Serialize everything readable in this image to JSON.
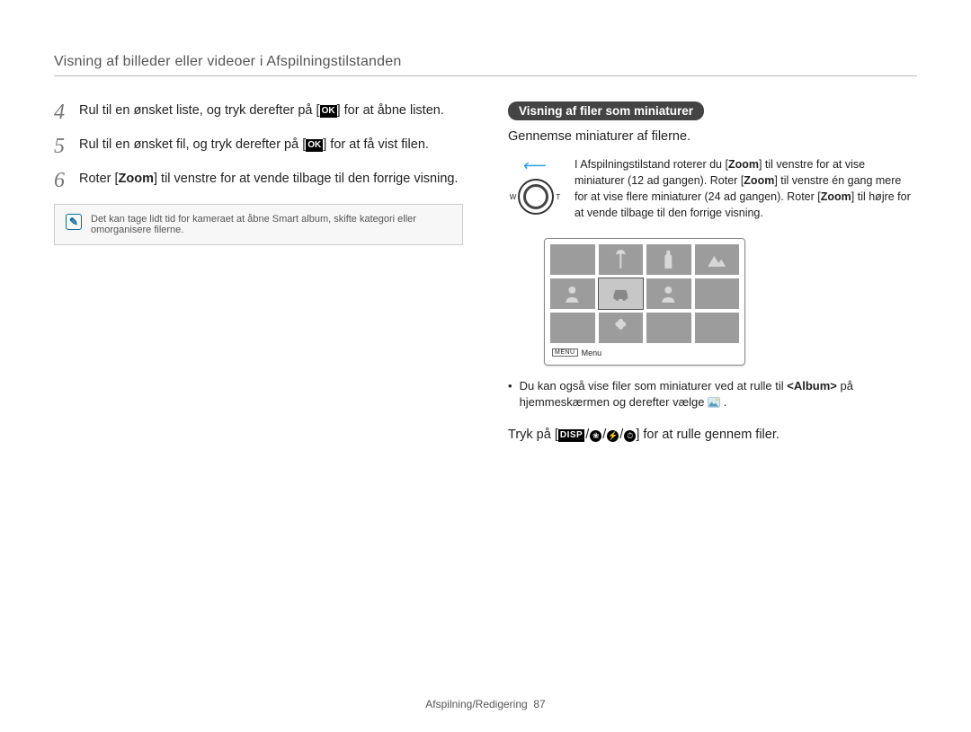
{
  "header": {
    "title": "Visning af billeder eller videoer i Afspilningstilstanden"
  },
  "left": {
    "steps": [
      {
        "n": "4",
        "pre": "Rul til en ønsket liste, og tryk derefter på [",
        "glyph": "OK",
        "post": "] for at åbne listen."
      },
      {
        "n": "5",
        "pre": "Rul til en ønsket fil, og tryk derefter på [",
        "glyph": "OK",
        "post": "] for at få vist filen."
      },
      {
        "n": "6",
        "pre": "Roter [",
        "bold": "Zoom",
        "post": "] til venstre for at vende tilbage til den forrige visning."
      }
    ],
    "note": "Det kan tage lidt tid for kameraet at åbne Smart album, skifte kategori eller omorganisere filerne."
  },
  "right": {
    "badge": "Visning af filer som miniaturer",
    "subtitle": "Gennemse miniaturer af filerne.",
    "w_label": "W",
    "t_label": "T",
    "info_parts": {
      "p1": "I Afspilningstilstand roterer du [",
      "z1": "Zoom",
      "p2": "] til venstre for at vise miniaturer (12 ad gangen). Roter [",
      "z2": "Zoom",
      "p3": "] til venstre én gang mere for at vise flere miniaturer (24 ad gangen). Roter [",
      "z3": "Zoom",
      "p4": "] til højre for at vende tilbage til den forrige visning."
    },
    "menu_label": "Menu",
    "menu_chip": "MENU",
    "bullet": {
      "p1": "Du kan også vise filer som miniaturer ved at rulle til ",
      "album": "<Album>",
      "p2": " på hjemmeskærmen og derefter vælge "
    },
    "scroll": {
      "pre": "Tryk på [",
      "disp": "DISP",
      "post": "] for at rulle gennem filer."
    }
  },
  "footer": {
    "section": "Afspilning/Redigering",
    "page": "87"
  }
}
